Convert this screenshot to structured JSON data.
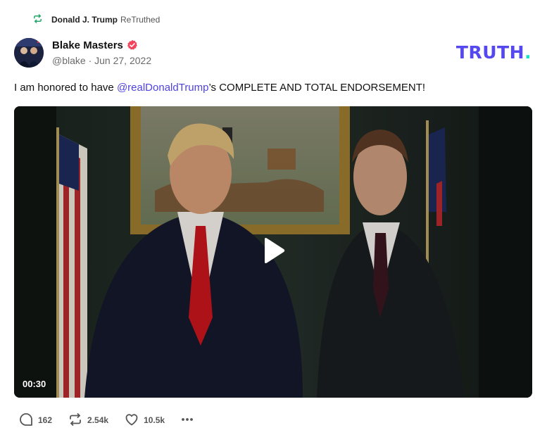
{
  "retruth": {
    "user": "Donald J. Trump",
    "action": "ReTruthed",
    "icon": "retruth-icon"
  },
  "author": {
    "name": "Blake Masters",
    "handle": "@blake",
    "separator": "·",
    "date": "Jun 27, 2022",
    "verified_icon": "verified-badge-icon",
    "verified_color": "#f0455c"
  },
  "brand": {
    "logo_text": "TRUTH",
    "logo_dot": ".",
    "color": "#5448ee",
    "dot_color": "#17e0c5"
  },
  "post": {
    "text_before": "I am honored to have ",
    "mention": "@realDonaldTrump",
    "text_after": "’s COMPLETE AND TOTAL ENDORSEMENT!",
    "mention_color": "#4f43e0"
  },
  "video": {
    "duration": "00:30",
    "play_icon": "play-icon"
  },
  "actions": {
    "replies": "162",
    "retruths": "2.54k",
    "likes": "10.5k",
    "reply_icon": "reply-icon",
    "retruth_icon": "retruth-icon",
    "like_icon": "heart-icon",
    "more_icon": "more-icon"
  }
}
